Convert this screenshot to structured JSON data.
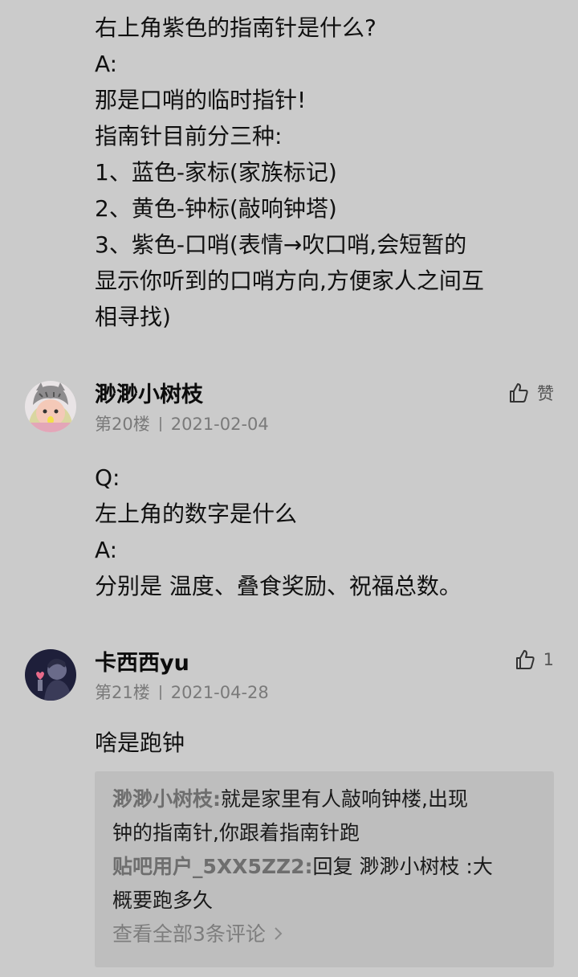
{
  "intro_post": {
    "lines": [
      "右上角紫色的指南针是什么?",
      "A:",
      "那是口哨的临时指针!",
      "指南针目前分三种:",
      "1、蓝色-家标(家族标记)",
      "2、黄色-钟标(敲响钟塔)",
      "3、紫色-口哨(表情→吹口哨,会短暂的",
      "显示你听到的口哨方向,方便家人之间互",
      "相寻找)"
    ]
  },
  "floors": [
    {
      "username": "渺渺小树枝",
      "floor": "第20楼",
      "date": "2021-02-04",
      "like_label": "赞",
      "like_icon": "thumbs-up-icon",
      "avatar_icon": "cartoon-girl-avatar",
      "content": [
        "Q:",
        "左上角的数字是什么",
        "A:",
        "分别是 温度、叠食奖励、祝福总数。"
      ]
    },
    {
      "username": "卡西西yu",
      "floor": "第21楼",
      "date": "2021-04-28",
      "like_label": "1",
      "like_icon": "thumbs-up-icon",
      "avatar_icon": "dark-portrait-avatar",
      "content": [
        "啥是跑钟"
      ],
      "sub_replies": [
        {
          "user": "渺渺小树枝:",
          "lines": [
            "就是家里有人敲响钟楼,出现",
            "钟的指南针,你跟着指南针跑"
          ]
        },
        {
          "user": "贴吧用户_5XX5ZZ2:",
          "lines": [
            "回复 渺渺小树枝 :大",
            "概要跑多久"
          ]
        }
      ],
      "view_all": "查看全部3条评论",
      "view_all_icon": "chevron-right-icon"
    }
  ]
}
